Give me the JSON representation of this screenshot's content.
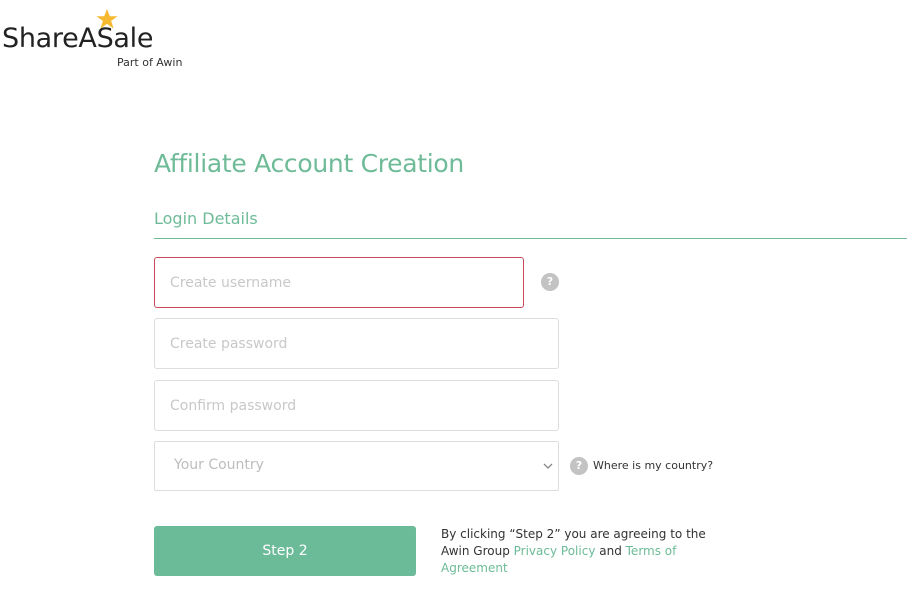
{
  "logo": {
    "brand": "ShareASale",
    "tagline": "Part of Awin",
    "star_color": "#f5b82e"
  },
  "page": {
    "title": "Affiliate Account Creation",
    "section_title": "Login Details"
  },
  "form": {
    "username_placeholder": "Create username",
    "password_placeholder": "Create password",
    "confirm_placeholder": "Confirm password",
    "country_value": "Your Country",
    "country_help_label": "Where is my country?",
    "help_glyph": "?"
  },
  "actions": {
    "step_label": "Step 2",
    "terms_prefix": "By clicking “Step 2” you are agreeing to the Awin Group ",
    "privacy_link": "Privacy Policy",
    "terms_and": " and ",
    "terms_link": "Terms of Agreement"
  },
  "colors": {
    "accent": "#6fbb98",
    "error_border": "#c84a5a",
    "help_icon": "#c3c3c3"
  }
}
